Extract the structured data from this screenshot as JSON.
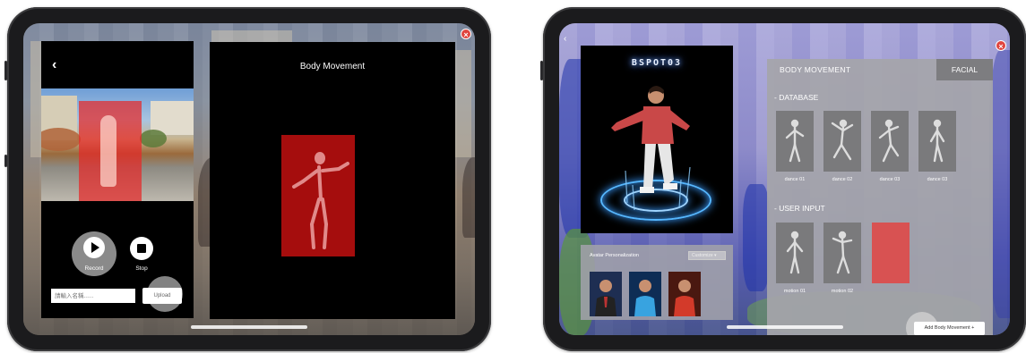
{
  "left_tablet": {
    "back_icon": "chevron-left-icon",
    "close_icon": "close-icon",
    "record_label": "Record",
    "stop_label": "Stop",
    "name_placeholder": "請輸入名稱......",
    "upload_label": "Upload",
    "preview_title": "Body Movement",
    "colors": {
      "panel": "#000000",
      "highlight": "#e62828",
      "figure_bg": "#a50d0d"
    }
  },
  "right_tablet": {
    "back_icon": "chevron-left-icon",
    "close_icon": "close-icon",
    "neon_sign": "BSPOT03",
    "persona": {
      "title": "Avatar Personalization",
      "select_value": "Customize",
      "avatars": [
        "avatar-suit",
        "avatar-blue",
        "avatar-red"
      ]
    },
    "header_title": "BODY MOVEMENT",
    "facial_tab": "FACIAL",
    "database_heading": "- DATABASE",
    "database_items": [
      "dance 01",
      "dance 02",
      "dance 03",
      "dance 03"
    ],
    "user_input_heading": "- USER INPUT",
    "user_items": [
      "motion 01",
      "motion 02"
    ],
    "add_button": "Add Body Movement +",
    "colors": {
      "panel": "#a5a5aa",
      "facial_tab": "#7d7d80",
      "red_slot": "#d85252"
    }
  }
}
